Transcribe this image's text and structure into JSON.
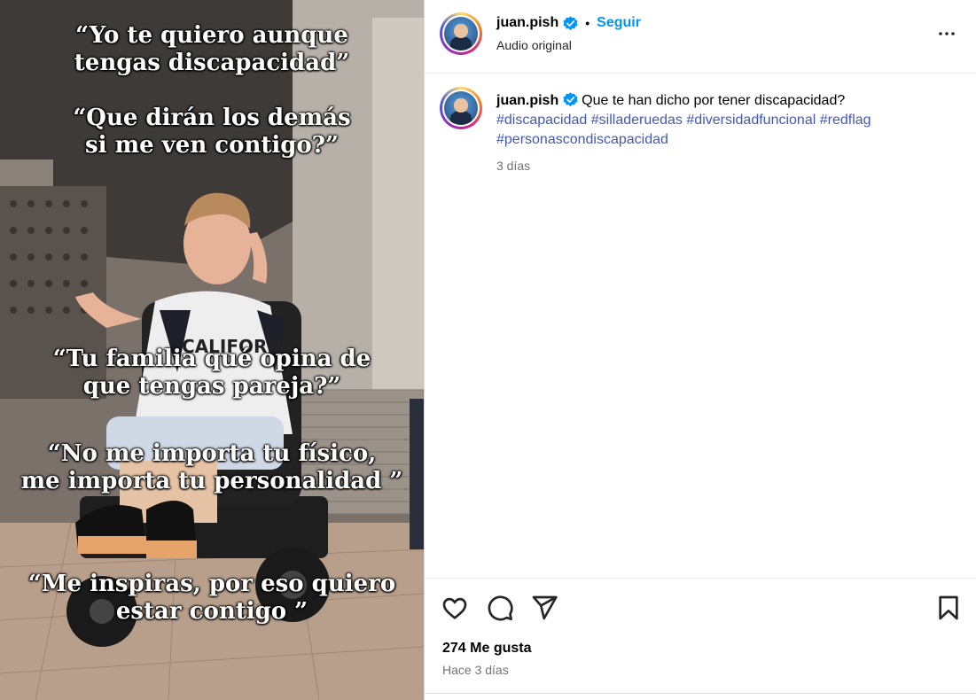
{
  "media": {
    "captions": [
      "“Yo te quiero aunque\ntengas discapacidad”",
      "“Que dirán los demás\nsi me ven contigo?”",
      "“Tu familia qué opina de\nque tengas pareja?”",
      "“No me importa tu físico,\nme importa tu personalidad ”",
      "“Me inspiras, por eso quiero\nestar contigo ”"
    ],
    "shirt_text": "CALIFORNI"
  },
  "header": {
    "username": "juan.pish",
    "separator": "•",
    "follow_label": "Seguir",
    "subtitle": "Audio original"
  },
  "post": {
    "username": "juan.pish",
    "caption": "Que te han dicho por tener discapacidad?",
    "hashtags": [
      "#discapacidad",
      "#silladeruedas",
      "#diversidadfuncional",
      "#redflag",
      "#personascondiscapacidad"
    ],
    "time": "3 días"
  },
  "footer": {
    "likes": "274 Me gusta",
    "ago": "Hace 3 días"
  },
  "icons": {
    "like": "heart-icon",
    "comment": "comment-icon",
    "share": "share-icon",
    "save": "bookmark-icon",
    "more": "more-options-icon",
    "verified": "verified-badge-icon"
  },
  "colors": {
    "accent": "#0095f6",
    "verified": "#0095f6",
    "hashtag": "#4358b8",
    "muted": "#737373"
  }
}
